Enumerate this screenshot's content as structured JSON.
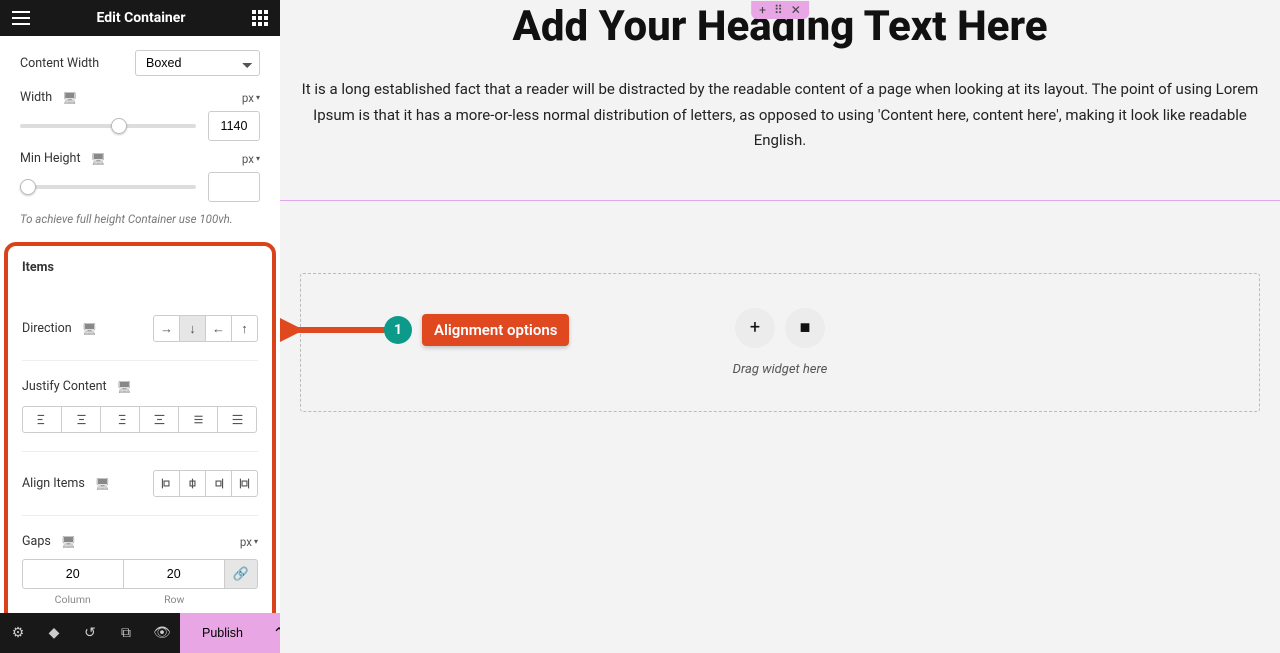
{
  "header": {
    "title": "Edit Container"
  },
  "panel": {
    "content_width_label": "Content Width",
    "content_width_value": "Boxed",
    "width_label": "Width",
    "width_unit": "px",
    "width_value": "1140",
    "min_height_label": "Min Height",
    "min_height_unit": "px",
    "min_height_value": "",
    "hint": "To achieve full height Container use 100vh.",
    "items_title": "Items",
    "direction_label": "Direction",
    "direction_options": [
      "right",
      "down",
      "left",
      "up"
    ],
    "direction_active": "down",
    "justify_label": "Justify Content",
    "align_items_label": "Align Items",
    "gaps_label": "Gaps",
    "gaps_unit": "px",
    "gap_column": "20",
    "gap_row": "20",
    "column_label": "Column",
    "row_label": "Row"
  },
  "footer": {
    "publish": "Publish"
  },
  "canvas": {
    "heading": "Add Your Heading Text Here",
    "paragraph": "It is a long established fact that a reader will be distracted by the readable content of a page when looking at its layout. The point of using Lorem Ipsum is that it has a more-or-less normal distribution of letters, as opposed to using 'Content here, content here', making it look like readable English.",
    "dropzone_label": "Drag widget here"
  },
  "annotation": {
    "step": "1",
    "label": "Alignment options"
  }
}
